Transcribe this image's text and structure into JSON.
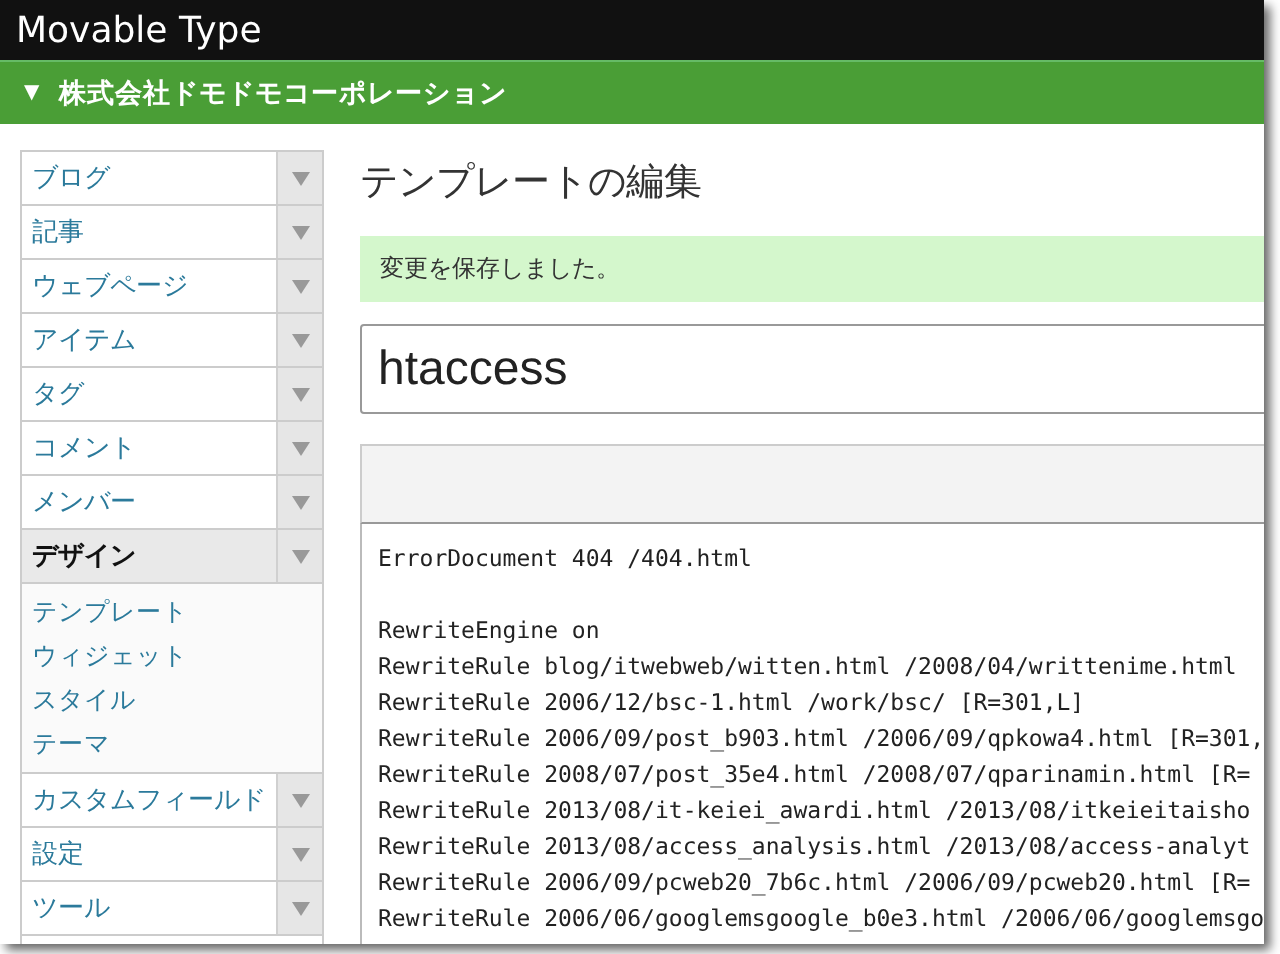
{
  "app_bar": {
    "title": "Movable Type"
  },
  "site_bar": {
    "toggle": "▼",
    "name": "株式会社ドモドモコーポレーション"
  },
  "sidebar": {
    "items": [
      {
        "label": "ブログ",
        "selected": false
      },
      {
        "label": "記事",
        "selected": false
      },
      {
        "label": "ウェブページ",
        "selected": false
      },
      {
        "label": "アイテム",
        "selected": false
      },
      {
        "label": "タグ",
        "selected": false
      },
      {
        "label": "コメント",
        "selected": false
      },
      {
        "label": "メンバー",
        "selected": false
      },
      {
        "label": "デザイン",
        "selected": true,
        "children": [
          {
            "label": "テンプレート"
          },
          {
            "label": "ウィジェット"
          },
          {
            "label": "スタイル"
          },
          {
            "label": "テーマ"
          }
        ]
      },
      {
        "label": "カスタムフィールド",
        "selected": false
      },
      {
        "label": "設定",
        "selected": false
      },
      {
        "label": "ツール",
        "selected": false
      }
    ]
  },
  "main": {
    "title": "テンプレートの編集",
    "message": "変更を保存しました。",
    "template_name": "htaccess",
    "code_blocks": [
      [
        "ErrorDocument 404 /404.html"
      ],
      [
        "RewriteEngine on",
        "RewriteRule blog/itwebweb/witten.html /2008/04/writtenime.html",
        "RewriteRule 2006/12/bsc-1.html /work/bsc/ [R=301,L]",
        "RewriteRule 2006/09/post_b903.html /2006/09/qpkowa4.html [R=301,",
        "RewriteRule 2008/07/post_35e4.html /2008/07/qparinamin.html [R=",
        "RewriteRule 2013/08/it-keiei_awardi.html /2013/08/itkeieitaisho",
        "RewriteRule 2013/08/access_analysis.html /2013/08/access-analyt",
        "RewriteRule 2006/09/pcweb20_7b6c.html /2006/09/pcweb20.html [R=",
        "RewriteRule 2006/06/googlemsgoogle_b0e3.html /2006/06/googlemsgo"
      ]
    ]
  }
}
